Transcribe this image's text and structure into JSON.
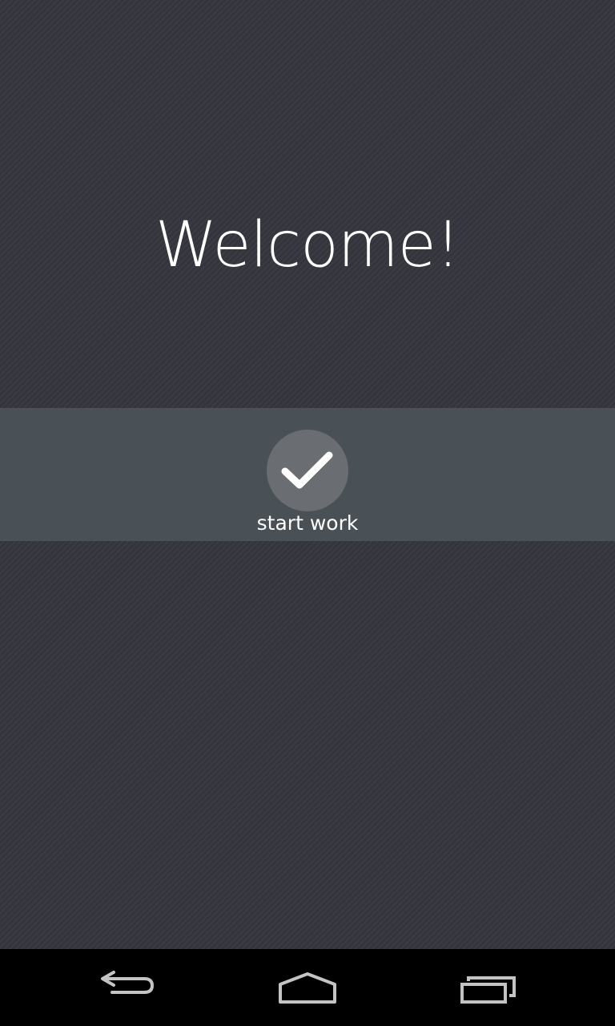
{
  "welcome": {
    "title": "Welcome!"
  },
  "start_button": {
    "icon": "check-icon",
    "label": "start work"
  },
  "navbar": {
    "back_icon": "back-arrow-icon",
    "home_icon": "home-icon",
    "recents_icon": "recent-apps-icon"
  },
  "colors": {
    "background": "#34343c",
    "band": "#495056",
    "button_circle": "#6a6d71",
    "text": "#ffffff",
    "navbar": "#000000"
  }
}
